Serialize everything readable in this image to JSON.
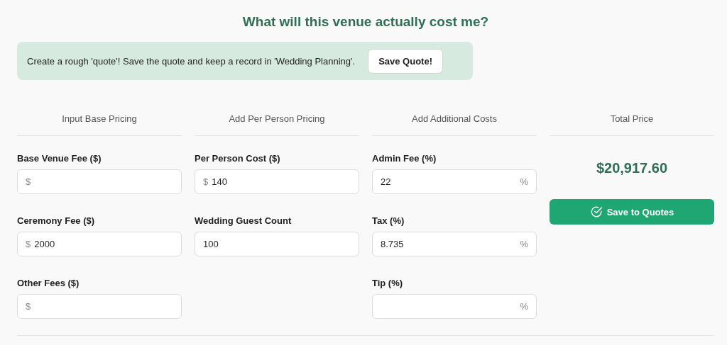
{
  "title": "What will this venue actually cost me?",
  "banner": {
    "text": "Create a rough 'quote'! Save the quote and keep a record in 'Wedding Planning'.",
    "button": "Save Quote!"
  },
  "columns": [
    {
      "heading": "Input Base Pricing",
      "fields": [
        {
          "label": "Base Venue Fee ($)",
          "prefix": "$"
        },
        {
          "label": "Ceremony Fee ($)",
          "prefix": "$",
          "value": "2000"
        },
        {
          "label": "Other Fees ($)",
          "prefix": "$"
        }
      ]
    },
    {
      "heading": "Add Per Person Pricing",
      "fields": [
        {
          "label": "Per Person Cost ($)",
          "prefix": "$",
          "value": "140"
        },
        {
          "label": "Wedding Guest Count",
          "value": "100"
        }
      ]
    },
    {
      "heading": "Add Additional Costs",
      "fields": [
        {
          "label": "Admin Fee (%)",
          "suffix": "%",
          "value": "22"
        },
        {
          "label": "Tax (%)",
          "suffix": "%",
          "value": "8.735"
        },
        {
          "label": "Tip (%)",
          "suffix": "%"
        }
      ]
    }
  ],
  "total": {
    "heading": "Total Price",
    "amount": "$20,917.60",
    "button": "Save to Quotes"
  }
}
